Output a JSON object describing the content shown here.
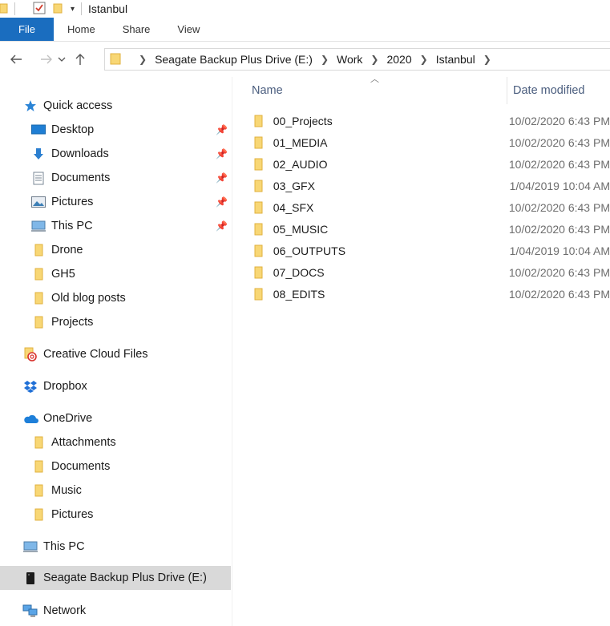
{
  "window": {
    "title": "Istanbul"
  },
  "ribbon": {
    "tabs": [
      {
        "label": "File"
      },
      {
        "label": "Home"
      },
      {
        "label": "Share"
      },
      {
        "label": "View"
      }
    ]
  },
  "address": {
    "crumbs": [
      "Seagate Backup Plus Drive (E:)",
      "Work",
      "2020",
      "Istanbul"
    ]
  },
  "nav": {
    "quick_access": "Quick access",
    "quick_items": [
      {
        "label": "Desktop",
        "icon": "desktop-icon"
      },
      {
        "label": "Downloads",
        "icon": "download-arrow-icon"
      },
      {
        "label": "Documents",
        "icon": "document-icon"
      },
      {
        "label": "Pictures",
        "icon": "pictures-icon"
      },
      {
        "label": "This PC",
        "icon": "computer-icon"
      },
      {
        "label": "Drone",
        "icon": "folder-icon"
      },
      {
        "label": "GH5",
        "icon": "folder-icon"
      },
      {
        "label": "Old blog posts",
        "icon": "folder-icon"
      },
      {
        "label": "Projects",
        "icon": "folder-icon"
      }
    ],
    "creative_cloud": "Creative Cloud Files",
    "dropbox": "Dropbox",
    "onedrive": "OneDrive",
    "onedrive_items": [
      "Attachments",
      "Documents",
      "Music",
      "Pictures"
    ],
    "this_pc": "This PC",
    "drive": "Seagate Backup Plus Drive (E:)",
    "network": "Network"
  },
  "content": {
    "col_name": "Name",
    "col_date": "Date modified",
    "files": [
      {
        "name": "00_Projects",
        "date": "10/02/2020 6:43 PM"
      },
      {
        "name": "01_MEDIA",
        "date": "10/02/2020 6:43 PM"
      },
      {
        "name": "02_AUDIO",
        "date": "10/02/2020 6:43 PM"
      },
      {
        "name": "03_GFX",
        "date": "1/04/2019 10:04 AM"
      },
      {
        "name": "04_SFX",
        "date": "10/02/2020 6:43 PM"
      },
      {
        "name": "05_MUSIC",
        "date": "10/02/2020 6:43 PM"
      },
      {
        "name": "06_OUTPUTS",
        "date": "1/04/2019 10:04 AM"
      },
      {
        "name": "07_DOCS",
        "date": "10/02/2020 6:43 PM"
      },
      {
        "name": "08_EDITS",
        "date": "10/02/2020 6:43 PM"
      }
    ]
  },
  "colors": {
    "file_tab": "#1a6dbf",
    "folder_yellow": "#f8d775",
    "selected_row": "#d9d9d9",
    "header_text": "#4a5d7e"
  }
}
